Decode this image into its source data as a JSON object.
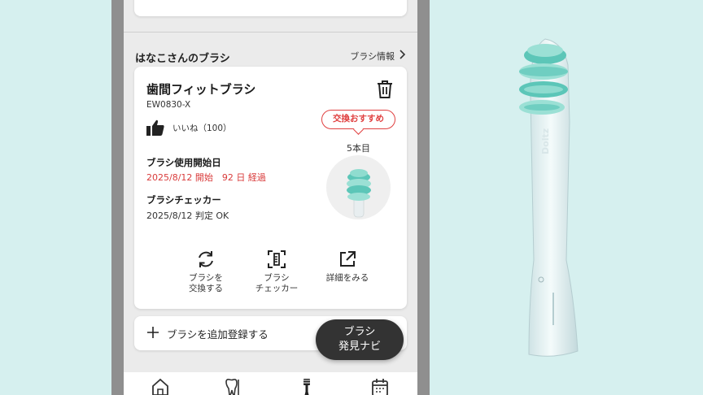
{
  "section": {
    "title": "はなこさんのブラシ",
    "info_link": "ブラシ情報",
    "info_chevron": "chevron-right-icon"
  },
  "brush": {
    "name": "歯間フィットブラシ",
    "model": "EW0830-X",
    "like_label": "いいね（100）",
    "badge": "交換おすすめ",
    "count": "5本目",
    "start_label": "ブラシ使用開始日",
    "start_value": "2025/8/12 開始　92 日 経過",
    "checker_label": "ブラシチェッカー",
    "checker_value": "2025/8/12 判定 OK"
  },
  "actions": [
    {
      "label": "ブラシを\n交換する",
      "icon": "refresh-icon"
    },
    {
      "label": "ブラシ\nチェッカー",
      "icon": "scan-icon"
    },
    {
      "label": "詳細をみる",
      "icon": "external-link-icon"
    }
  ],
  "add_button": "ブラシを追加登録する",
  "fab": "ブラシ\n発見ナビ",
  "tabbar": [
    {
      "icon": "home-icon",
      "active": false
    },
    {
      "icon": "dental-care-icon",
      "active": false
    },
    {
      "icon": "toothbrush-icon",
      "active": true
    },
    {
      "icon": "calendar-icon",
      "active": false
    }
  ],
  "product_brand": "Doltz",
  "colors": {
    "background": "#d6f0ef",
    "accent_red": "#e04040",
    "bristle_teal": "#5cc6b8",
    "fab": "#333333"
  }
}
